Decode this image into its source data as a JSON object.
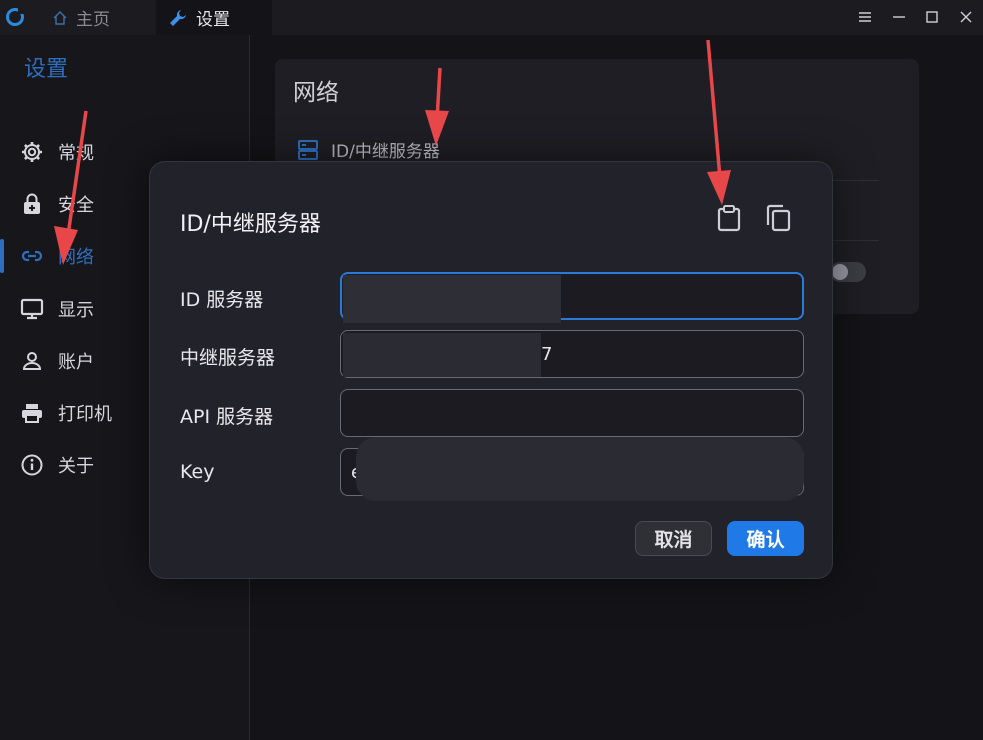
{
  "tabs": [
    {
      "label": "主页",
      "icon": "home-icon"
    },
    {
      "label": "设置",
      "icon": "wrench-icon"
    }
  ],
  "sidebar": {
    "title": "设置",
    "items": [
      {
        "label": "常规",
        "icon": "gear-icon"
      },
      {
        "label": "安全",
        "icon": "lock-icon"
      },
      {
        "label": "网络",
        "icon": "link-icon",
        "active": true
      },
      {
        "label": "显示",
        "icon": "monitor-icon"
      },
      {
        "label": "账户",
        "icon": "person-icon"
      },
      {
        "label": "打印机",
        "icon": "printer-icon"
      },
      {
        "label": "关于",
        "icon": "info-icon"
      }
    ]
  },
  "section": {
    "title": "网络",
    "item_label": "ID/中继服务器"
  },
  "dialog": {
    "title": "ID/中继服务器",
    "fields": [
      {
        "label": "ID 服务器",
        "value": ""
      },
      {
        "label": "中继服务器",
        "value": "7"
      },
      {
        "label": "API 服务器",
        "value": ""
      },
      {
        "label": "Key",
        "value": "e"
      }
    ],
    "cancel_label": "取消",
    "confirm_label": "确认"
  },
  "colors": {
    "accent": "#1f7ae8",
    "annotation_arrow": "#e8474a"
  }
}
